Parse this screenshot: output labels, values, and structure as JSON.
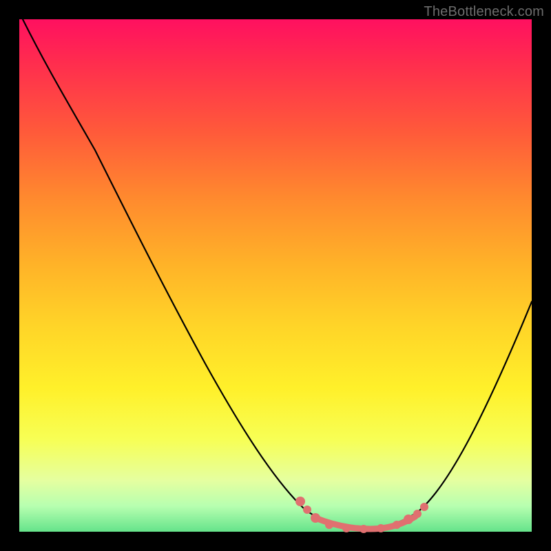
{
  "watermark": "TheBottleneck.com",
  "colors": {
    "accent_dots": "#e07070",
    "curve": "#000000",
    "background_top": "#ff1060",
    "background_bottom": "#65e38b",
    "frame": "#000000"
  },
  "chart_data": {
    "type": "line",
    "title": "",
    "xlabel": "",
    "ylabel": "",
    "xlim": [
      0,
      100
    ],
    "ylim": [
      0,
      100
    ],
    "grid": false,
    "legend": false,
    "series": [
      {
        "name": "bottleneck-curve",
        "x": [
          0,
          5,
          10,
          15,
          20,
          25,
          30,
          35,
          40,
          45,
          50,
          55,
          58,
          60,
          62,
          65,
          68,
          72,
          75,
          80,
          85,
          90,
          95,
          100
        ],
        "values": [
          100,
          95,
          88,
          80,
          71,
          62,
          53,
          44,
          35,
          26,
          17,
          10,
          6,
          3,
          1,
          0,
          0,
          0,
          1,
          5,
          12,
          22,
          34,
          48
        ]
      }
    ],
    "markers": {
      "name": "highlight-dots",
      "x": [
        55,
        57,
        60,
        63,
        66,
        69,
        72,
        74,
        76,
        78
      ],
      "values": [
        8,
        5,
        2,
        0,
        0,
        0,
        0,
        1,
        2,
        4
      ]
    }
  }
}
